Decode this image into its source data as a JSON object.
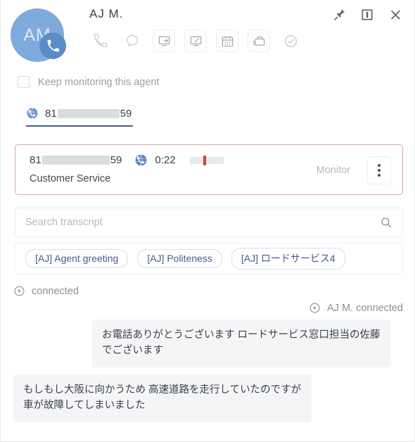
{
  "header": {
    "title": "AJ M.",
    "avatar_initials": "AM",
    "avatar_badge_icon": "phone-icon",
    "avatar_color": "#7fabdc",
    "badge_color": "#5a8cc8",
    "window_actions": [
      {
        "name": "pin-icon",
        "label": "Pin"
      },
      {
        "name": "panel-toggle-icon",
        "label": "Toggle panel"
      },
      {
        "name": "close-icon",
        "label": "Close"
      }
    ],
    "toolbar": [
      {
        "name": "phone-icon",
        "label": "Call",
        "boxed": false
      },
      {
        "name": "chat-bubble-icon",
        "label": "Chat",
        "boxed": false
      },
      {
        "name": "screen-share-icon",
        "label": "Screen share",
        "boxed": true
      },
      {
        "name": "screen-icon",
        "label": "Screen",
        "boxed": true
      },
      {
        "name": "calendar-icon",
        "label": "Calendar",
        "boxed": true
      },
      {
        "name": "briefcase-icon",
        "label": "Workbin",
        "boxed": true
      },
      {
        "name": "check-circle-icon",
        "label": "Mark done",
        "boxed": false
      }
    ]
  },
  "keep_monitoring": {
    "label": "Keep monitoring this agent",
    "checked": false
  },
  "number_tab": {
    "icon": "phone-globe-icon",
    "prefix": "81",
    "suffix": "59",
    "redacted": true,
    "underline_color": "#4a5b8c"
  },
  "call_card": {
    "border_color": "#d4a8a6",
    "number_prefix": "81",
    "number_suffix": "59",
    "icon": "phone-globe-icon",
    "duration": "0:22",
    "sentiment_marker_color": "#c9433e",
    "queue": "Customer Service",
    "monitor_label": "Monitor",
    "menu_icon": "kebab-menu-icon"
  },
  "search": {
    "placeholder": "Search transcript",
    "value": "",
    "icon": "search-icon"
  },
  "chips": [
    {
      "label": "[AJ] Agent greeting"
    },
    {
      "label": "[AJ] Politeness"
    },
    {
      "label": "[AJ] ロードサービス4"
    }
  ],
  "transcript": [
    {
      "type": "system",
      "align": "left",
      "icon": "event-circle-icon",
      "text": "connected"
    },
    {
      "type": "system",
      "align": "right",
      "icon": "event-circle-icon",
      "text": "AJ M. connected"
    },
    {
      "type": "message",
      "side": "agent",
      "text": "お電話ありがとうございます ロードサービス窓口担当の佐藤でございます"
    },
    {
      "type": "message",
      "side": "customer",
      "text": "もしもし大阪に向かうため 高速道路を走行していたのですが 車が故障してしまいました"
    }
  ]
}
